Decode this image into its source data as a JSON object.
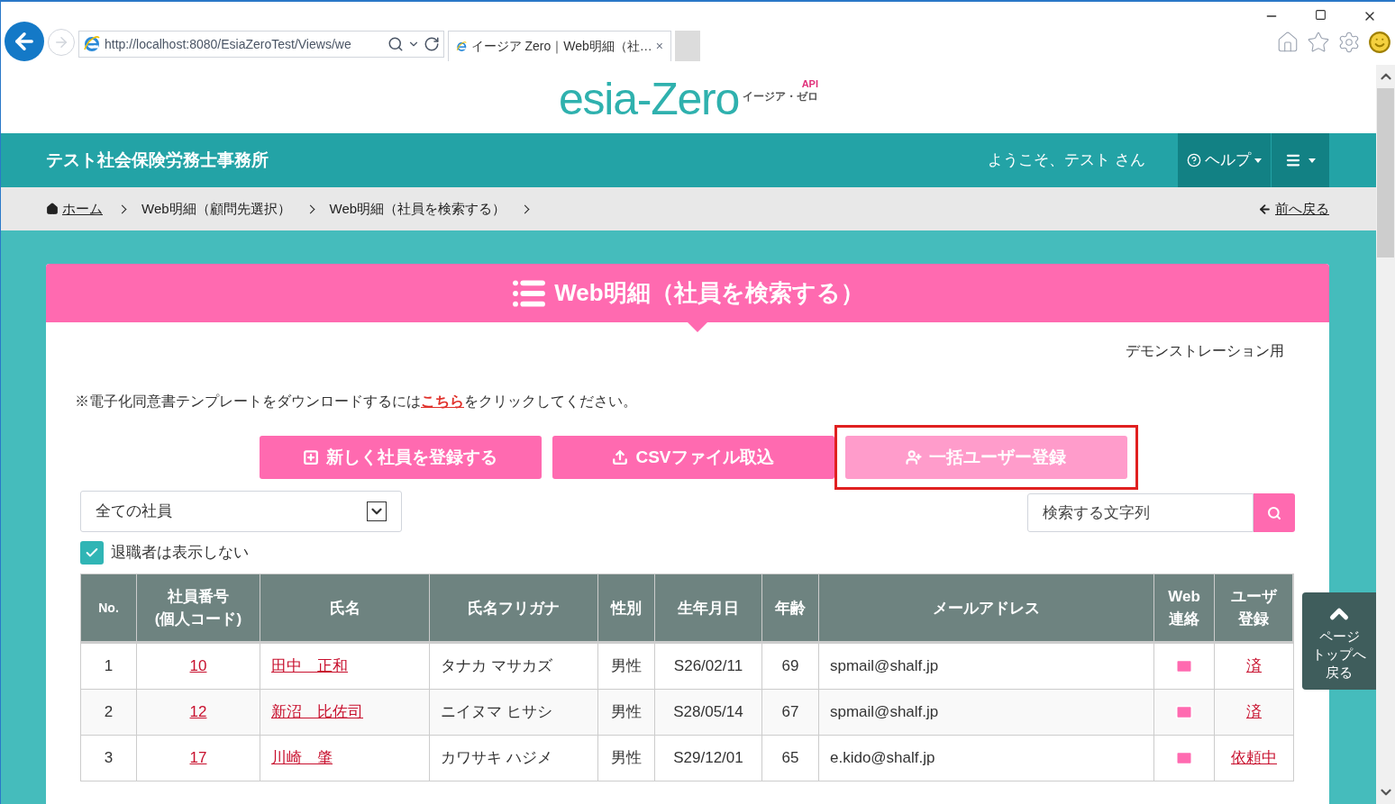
{
  "browser": {
    "address": "http://localhost:8080/EsiaZeroTest/Views/we",
    "tab_title": "イージア Zero｜Web明細（社…",
    "tab_close": "×"
  },
  "logo": {
    "main": "esia-Zero",
    "sub": "イージア・ゼロ",
    "badge": "API"
  },
  "header": {
    "office": "テスト社会保険労務士事務所",
    "welcome": "ようこそ、テスト さん",
    "help": "ヘルプ"
  },
  "breadcrumb": {
    "items": [
      "ホーム",
      "Web明細（顧問先選択）",
      "Web明細（社員を検索する）"
    ],
    "back": "前へ戻る"
  },
  "card": {
    "title": "Web明細（社員を検索する）",
    "note": "デモンストレーション用",
    "notice": "※電子化同意書テンプレートをダウンロードするには**こちら**をクリックしてください。"
  },
  "buttons": [
    {
      "kind": "plus",
      "label": "新しく社員を登録する",
      "disabled": false,
      "highlighted": false
    },
    {
      "kind": "upload",
      "label": "CSVファイル取込",
      "disabled": false,
      "highlighted": false
    },
    {
      "kind": "user-plus",
      "label": "一括ユーザー登録",
      "disabled": true,
      "highlighted": true
    }
  ],
  "filter": {
    "value": "全ての社員"
  },
  "search": {
    "placeholder": "検索する文字列"
  },
  "hide_retired": {
    "label": "退職者は表示しない",
    "checked": true
  },
  "table": {
    "columns": [
      [
        "No."
      ],
      [
        "社員番号",
        "(個人コード)"
      ],
      [
        "氏名"
      ],
      [
        "氏名フリガナ"
      ],
      [
        "性別"
      ],
      [
        "生年月日"
      ],
      [
        "年齢"
      ],
      [
        "メールアドレス"
      ],
      [
        "Web",
        "連絡"
      ],
      [
        "ユーザ",
        "登録"
      ]
    ],
    "rows": [
      {
        "no": "1",
        "code": "10",
        "name": "田中　正和",
        "kana": "タナカ マサカズ",
        "sex": "男性",
        "birth": "S26/02/11",
        "age": "69",
        "email": "spmail@shalf.jp",
        "user": "済"
      },
      {
        "no": "2",
        "code": "12",
        "name": "新沼　比佐司",
        "kana": "ニイヌマ ヒサシ",
        "sex": "男性",
        "birth": "S28/05/14",
        "age": "67",
        "email": "spmail@shalf.jp",
        "user": "済"
      },
      {
        "no": "3",
        "code": "17",
        "name": "川崎　肇",
        "kana": "カワサキ ハジメ",
        "sex": "男性",
        "birth": "S29/12/01",
        "age": "65",
        "email": "e.kido@shalf.jp",
        "user": "依頼中"
      }
    ]
  },
  "page_top": [
    "ページ",
    "トップへ",
    "戻る"
  ]
}
